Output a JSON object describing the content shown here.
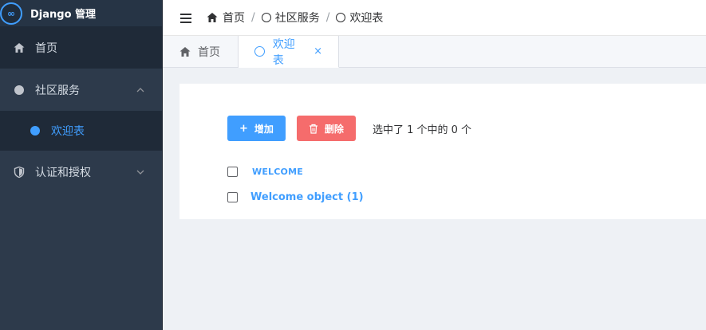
{
  "brand": {
    "title": "Django 管理",
    "logo_glyph": "∞"
  },
  "sidebar": {
    "items": [
      {
        "label": "首页",
        "icon": "home-icon"
      },
      {
        "label": "社区服务",
        "icon": "circle-icon",
        "expanded": true,
        "children": [
          {
            "label": "欢迎表",
            "active": true
          }
        ]
      },
      {
        "label": "认证和授权",
        "icon": "shield-icon",
        "expanded": false
      }
    ]
  },
  "breadcrumb": [
    {
      "label": "首页",
      "icon": "home-icon"
    },
    {
      "label": "社区服务",
      "icon": "circle-icon"
    },
    {
      "label": "欢迎表",
      "icon": "circle-icon"
    }
  ],
  "breadcrumb_separator": "/",
  "tabs": [
    {
      "label": "首页",
      "icon": "home-icon",
      "active": false
    },
    {
      "label": "欢迎表",
      "icon": "circle-icon",
      "active": true,
      "close_glyph": "×"
    }
  ],
  "toolbar": {
    "add_label": "增加",
    "add_icon_glyph": "+",
    "delete_label": "删除",
    "selection_text": "选中了 1 个中的 0 个"
  },
  "table": {
    "column_header": "WELCOME",
    "rows": [
      {
        "label": "Welcome object (1)"
      }
    ]
  },
  "colors": {
    "accent": "#409eff",
    "danger": "#f56c6c",
    "sidebar_bg": "#2d3a4b"
  }
}
